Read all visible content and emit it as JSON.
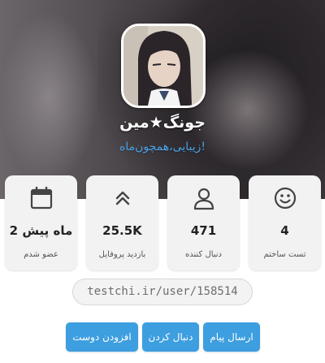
{
  "profile": {
    "username": "جونگ★مین",
    "bio": "زیبایی،همچون‌ماه!",
    "url": "testchi.ir/user/158514"
  },
  "stats": [
    {
      "icon": "smiley-icon",
      "value": "4",
      "label": "تست ساختم"
    },
    {
      "icon": "user-icon",
      "value": "471",
      "label": "دنبال کننده"
    },
    {
      "icon": "double-chevron-up-icon",
      "value": "25.5K",
      "label": "بازدید پروفایل"
    },
    {
      "icon": "calendar-icon",
      "value": "2 ماه پیش",
      "label": "عضو شدم"
    }
  ],
  "actions": {
    "send_message": "ارسال پیام",
    "follow": "دنبال کردن",
    "add_friend": "افزودن دوست"
  },
  "colors": {
    "accent": "#3d9ee0",
    "bio": "#4aa3e8",
    "card_bg": "#f2f2f2"
  }
}
